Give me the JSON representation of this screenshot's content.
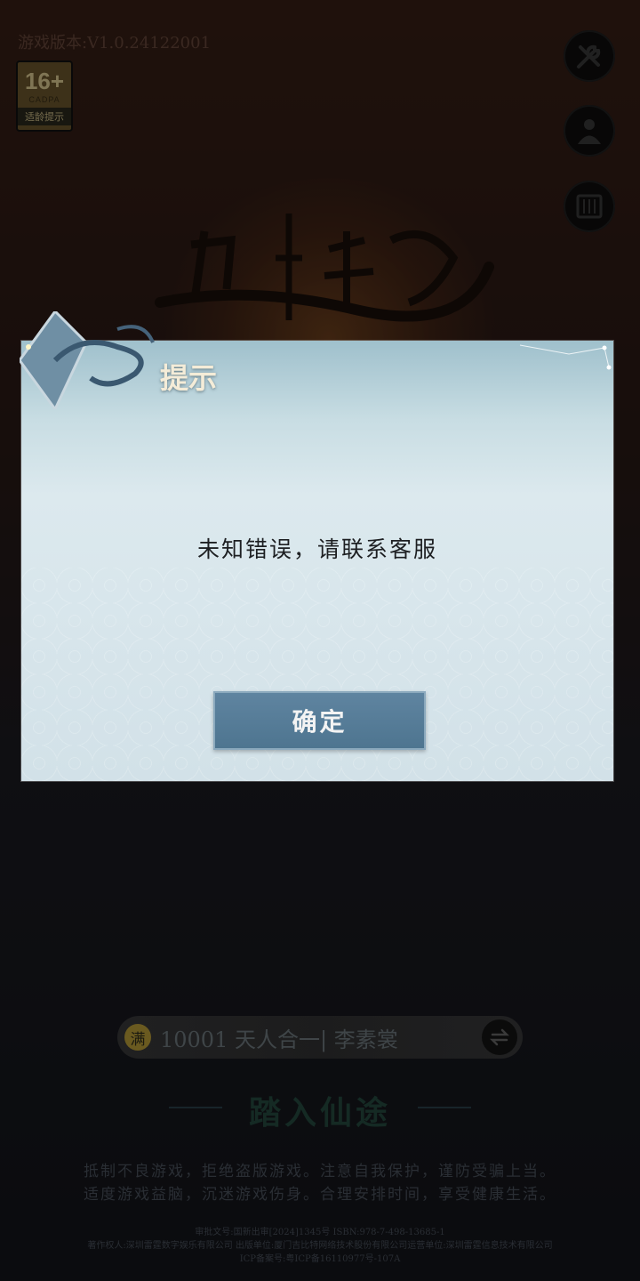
{
  "header": {
    "version_text": "游戏版本:V1.0.24122001",
    "age_rating": {
      "number": "16+",
      "org": "CADPA",
      "label": "适龄提示"
    }
  },
  "side_buttons": [
    {
      "icon": "tools-icon"
    },
    {
      "icon": "user-icon"
    },
    {
      "icon": "scroll-icon"
    }
  ],
  "dialog": {
    "title": "提示",
    "message": "未知错误，请联系客服",
    "confirm_label": "确定"
  },
  "server": {
    "icon_char": "满",
    "text": "10001 天人合一| 李素裳"
  },
  "enter_label": "踏入仙途",
  "health_notice": [
    "抵制不良游戏，拒绝盗版游戏。注意自我保护，谨防受骗上当。",
    "适度游戏益脑，沉迷游戏伤身。合理安排时间，享受健康生活。"
  ],
  "legal": [
    "审批文号:国新出审[2024]1345号 ISBN:978-7-498-13685-1",
    "著作权人:深圳雷霆数字娱乐有限公司 出版单位:厦门吉比特网络技术股份有限公司运营单位:深圳雷霆信息技术有限公司",
    "ICP备案号:粤ICP备16110977号-107A"
  ],
  "colors": {
    "dialog_title": "#f4ecd8",
    "confirm_button": "#5a7f9a",
    "background_top": "#3a2016"
  }
}
